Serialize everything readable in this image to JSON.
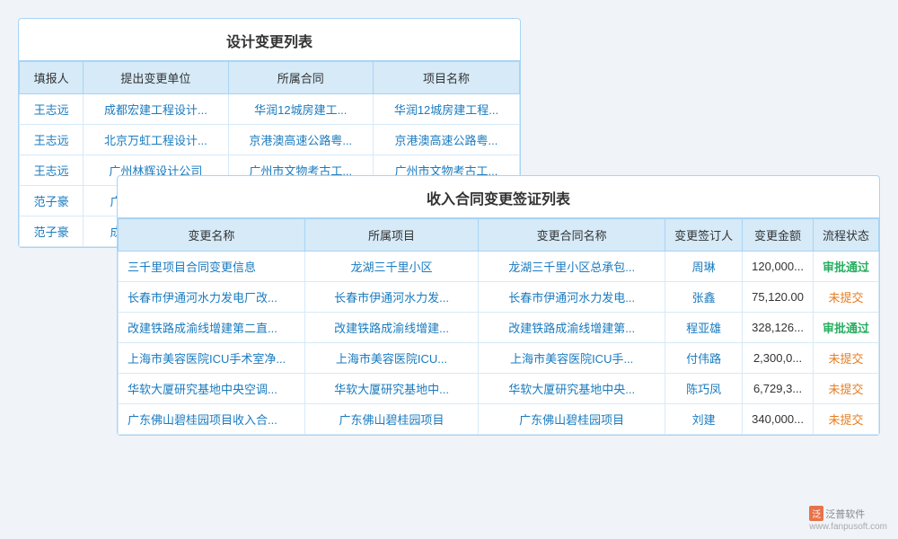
{
  "panel1": {
    "title": "设计变更列表",
    "headers": [
      "填报人",
      "提出变更单位",
      "所属合同",
      "项目名称"
    ],
    "rows": [
      {
        "reporter": "王志远",
        "unit": "成都宏建工程设计...",
        "contract": "华润12城房建工...",
        "project": "华润12城房建工程..."
      },
      {
        "reporter": "王志远",
        "unit": "北京万虹工程设计...",
        "contract": "京港澳高速公路粤...",
        "project": "京港澳高速公路粤..."
      },
      {
        "reporter": "王志远",
        "unit": "广州林辉设计公司",
        "contract": "广州市文物考古工...",
        "project": "广州市文物考古工..."
      },
      {
        "reporter": "范子豪",
        "unit": "广东鸿达鑫工程...",
        "contract": "",
        "project": ""
      },
      {
        "reporter": "范子豪",
        "unit": "成都浩海工程设...",
        "contract": "",
        "project": ""
      }
    ]
  },
  "panel2": {
    "title": "收入合同变更签证列表",
    "headers": [
      "变更名称",
      "所属项目",
      "变更合同名称",
      "变更签订人",
      "变更金额",
      "流程状态"
    ],
    "rows": [
      {
        "change_name": "三千里项目合同变更信息",
        "project": "龙湖三千里小区",
        "contract_name": "龙湖三千里小区总承包...",
        "signer": "周琳",
        "amount": "120,000...",
        "status": "审批通过",
        "status_class": "status-approved"
      },
      {
        "change_name": "长春市伊通河水力发电厂改...",
        "project": "长春市伊通河水力发...",
        "contract_name": "长春市伊通河水力发电...",
        "signer": "张鑫",
        "amount": "75,120.00",
        "status": "未提交",
        "status_class": "status-pending"
      },
      {
        "change_name": "改建铁路成渝线增建第二直...",
        "project": "改建铁路成渝线增建...",
        "contract_name": "改建铁路成渝线增建第...",
        "signer": "程亚雄",
        "amount": "328,126...",
        "status": "审批通过",
        "status_class": "status-approved"
      },
      {
        "change_name": "上海市美容医院ICU手术室净...",
        "project": "上海市美容医院ICU...",
        "contract_name": "上海市美容医院ICU手...",
        "signer": "付伟路",
        "amount": "2,300,0...",
        "status": "未提交",
        "status_class": "status-pending"
      },
      {
        "change_name": "华软大厦研究基地中央空调...",
        "project": "华软大厦研究基地中...",
        "contract_name": "华软大厦研究基地中央...",
        "signer": "陈巧凤",
        "amount": "6,729,3...",
        "status": "未提交",
        "status_class": "status-pending"
      },
      {
        "change_name": "广东佛山碧桂园项目收入合...",
        "project": "广东佛山碧桂园项目",
        "contract_name": "广东佛山碧桂园项目",
        "signer": "刘建",
        "amount": "340,000...",
        "status": "未提交",
        "status_class": "status-pending"
      }
    ]
  },
  "watermark": {
    "text": "泛普软件",
    "url": "www.fanpusoft.com"
  }
}
